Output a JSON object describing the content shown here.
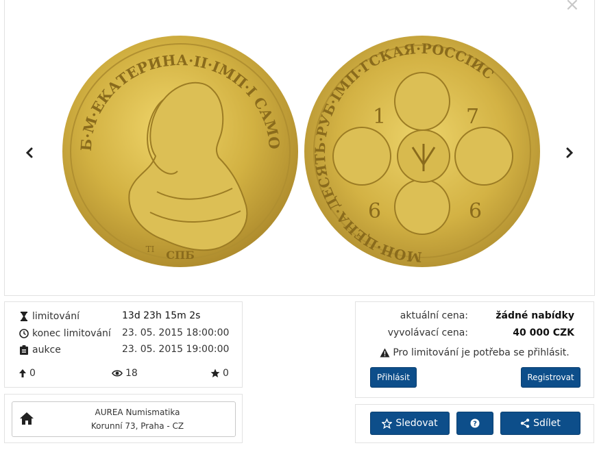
{
  "gallery": {
    "close_icon": "close-icon",
    "prev_icon": "chevron-left-icon",
    "next_icon": "chevron-right-icon"
  },
  "coin_obverse": {
    "legend": "Б·М·ЕКАТЕРИНА·II·ІМП·І САМОД·ВСЕРОС",
    "mint": "СПБ",
    "initials": "ТІ"
  },
  "coin_reverse": {
    "legend": "МОН·ЦЕНА·ДЕСЯТЬ·РУБ·ІМП·ГСКАЯ·РОССІИС",
    "digits": [
      "1",
      "7",
      "6",
      "6"
    ]
  },
  "timing": {
    "rows": [
      {
        "icon": "hourglass-icon",
        "label": "limitování",
        "value": "13d 23h 15m 2s"
      },
      {
        "icon": "clock-icon",
        "label": "konec limitování",
        "value": "23. 05. 2015 18:00:00"
      },
      {
        "icon": "clipboard-icon",
        "label": "aukce",
        "value": "23. 05. 2015 19:00:00"
      }
    ],
    "bids": "0",
    "views": "18",
    "stars": "0"
  },
  "price": {
    "current_label": "aktuální cena:",
    "current_value": "žádné nabídky",
    "start_label": "vyvolávací cena:",
    "start_value": "40 000 CZK",
    "notice": "Pro limitování je potřeba se přihlásit.",
    "login_label": "Přihlásit",
    "register_label": "Registrovat"
  },
  "seller": {
    "name": "AUREA Numismatika",
    "address": "Korunní 73, Praha - CZ"
  },
  "actions": {
    "follow_label": "Sledovat",
    "help_label": "?",
    "share_label": "Sdílet"
  },
  "colors": {
    "primary_button": "#0d4e8a",
    "gold": "#c9a83a"
  }
}
